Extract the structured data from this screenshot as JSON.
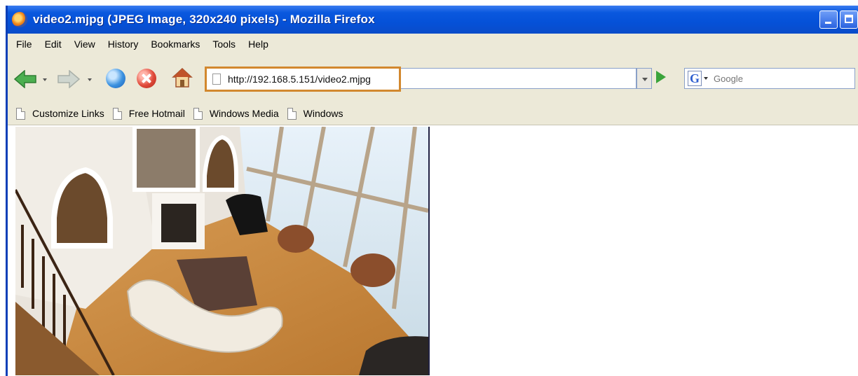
{
  "window": {
    "title": "video2.mjpg (JPEG Image, 320x240 pixels) - Mozilla Firefox"
  },
  "menu": [
    "File",
    "Edit",
    "View",
    "History",
    "Bookmarks",
    "Tools",
    "Help"
  ],
  "navigation": {
    "url": "http://192.168.5.151/video2.mjpg",
    "search_placeholder": "Google",
    "url_highlight_color": "#d2882e"
  },
  "bookmarks": [
    "Customize Links",
    "Free Hotmail",
    "Windows Media",
    "Windows"
  ],
  "content": {
    "image_alt": "Living room camera view"
  },
  "colors": {
    "titlebar": "#0551d8",
    "toolbar": "#ece9d8"
  }
}
